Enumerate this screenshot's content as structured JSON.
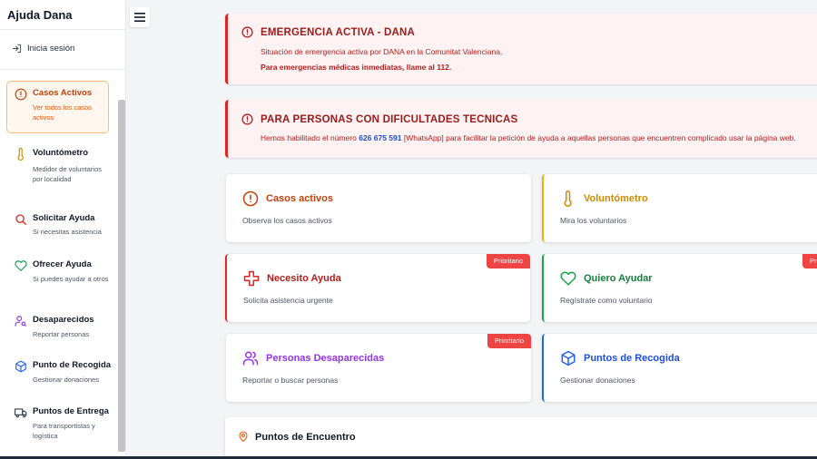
{
  "app": {
    "title": "Ajuda Dana"
  },
  "sidebar": {
    "login_label": "Inicia sesión",
    "items": [
      {
        "label": "Casos Activos",
        "desc": "Ver todos los casos activos",
        "icon": "alert-circle-icon",
        "color": "#c2410c",
        "active": true
      },
      {
        "label": "Voluntómetro",
        "desc": "Medidor de voluntarios por localidad",
        "icon": "thermometer-icon",
        "color": "#ca8a04"
      },
      {
        "label": "Solicitar Ayuda",
        "desc": "Si necesitas asistencia",
        "icon": "search-icon",
        "color": "#dc2626"
      },
      {
        "label": "Ofrecer Ayuda",
        "desc": "Si puedes ayudar a otros",
        "icon": "heart-icon",
        "color": "#16a34a"
      },
      {
        "label": "Desaparecidos",
        "desc": "Reportar personas",
        "icon": "user-search-icon",
        "color": "#9333ea"
      },
      {
        "label": "Punto de Recogida",
        "desc": "Gestionar donaciones",
        "icon": "package-icon",
        "color": "#2563eb"
      },
      {
        "label": "Puntos de Entrega",
        "desc": "Para transportistas y logística",
        "icon": "truck-icon",
        "color": "#374151"
      }
    ]
  },
  "alerts": {
    "emergency": {
      "title": "EMERGENCIA ACTIVA - DANA",
      "text": "Situación de emergencia activa por DANA en la Comunitat Valenciana.",
      "bold": "Para emergencias médicas inmediatas, llame al 112."
    },
    "difficulties": {
      "title": "PARA PERSONAS CON DIFICULTADES TECNICAS",
      "text_before": "Hemos habilitado el número ",
      "phone": "626 675 591",
      "text_after": " [WhatsApp] para facilitar la petición de ayuda a aquellas personas que encuentren complicado usar la página web."
    }
  },
  "cards": {
    "casos": {
      "title": "Casos activos",
      "desc": "Observa los casos activos",
      "color": "#c2410c"
    },
    "voluntometro": {
      "title": "Voluntómetro",
      "desc": "Mira los voluntarios",
      "color": "#ca8a04"
    },
    "necesito": {
      "title": "Necesito Ayuda",
      "desc": "Solicita asistencia urgente",
      "color": "#b91c1c",
      "badge": "Prioritario"
    },
    "quiero": {
      "title": "Quiero Ayudar",
      "desc": "Regístrate como voluntario",
      "color": "#15803d",
      "badge": "Prioritario"
    },
    "personas": {
      "title": "Personas Desaparecidas",
      "desc": "Reportar o buscar personas",
      "color": "#9333ea",
      "badge": "Prioritario"
    },
    "puntos": {
      "title": "Puntos de Recogida",
      "desc": "Gestionar donaciones",
      "color": "#1d4ed8"
    }
  },
  "section": {
    "title": "Puntos de Encuentro"
  }
}
